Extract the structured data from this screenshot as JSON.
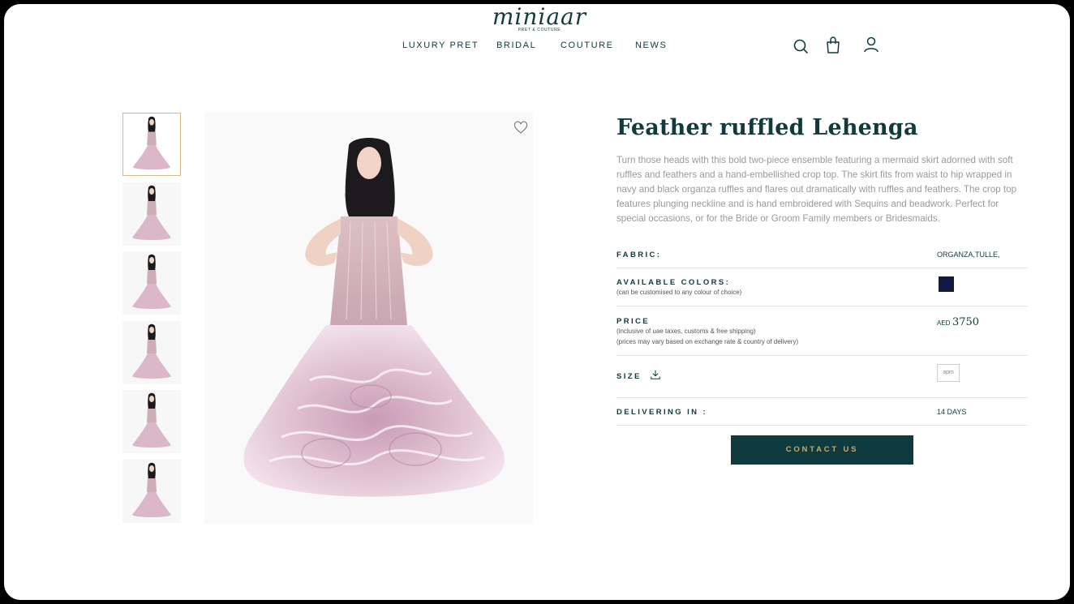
{
  "brand": {
    "name": "miniaar",
    "tagline": "PRET & COUTURE"
  },
  "nav": {
    "items": [
      {
        "label": "LUXURY PRET"
      },
      {
        "label": "BRIDAL"
      },
      {
        "label": "COUTURE"
      },
      {
        "label": "NEWS"
      }
    ],
    "icons": [
      "search-icon",
      "shopping-bag-icon",
      "user-icon"
    ]
  },
  "gallery": {
    "thumbnail_count": 6,
    "active_index": 0,
    "wishlist_icon": "heart-icon"
  },
  "product": {
    "title": "Feather ruffled Lehenga",
    "description": "Turn those heads with this bold two-piece ensemble featuring a mermaid skirt adorned with soft ruffles and feathers and a hand-embellished crop top. The skirt fits from waist to hip wrapped in navy and black organza ruffles and flares out dramatically with ruffles and feathers. The crop top features plunging neckline and is hand embroidered with Sequins and beadwork. Perfect for special occasions, or for the Bride or Groom Family members or Bridesmaids.",
    "fabric_label": "FABRIC:",
    "fabric_value": "ORGANZA,TULLE,",
    "colors_label": "AVAILABLE COLORS:",
    "colors_note": "(can be customised to any colour of choice)",
    "colors": [
      "#0f1a44"
    ],
    "price_label": "PRICE",
    "price_note_1": "(inclusive of uae taxes, customs & free shipping)",
    "price_note_2": "(prices may vary based on exchange rate & country of delivery)",
    "price_currency": "AED",
    "price_value": "3750",
    "size_label": "SIZE",
    "size_value": "apm",
    "delivery_label": "DELIVERING IN :",
    "delivery_value": "14 DAYS",
    "contact_label": "CONTACT US"
  }
}
